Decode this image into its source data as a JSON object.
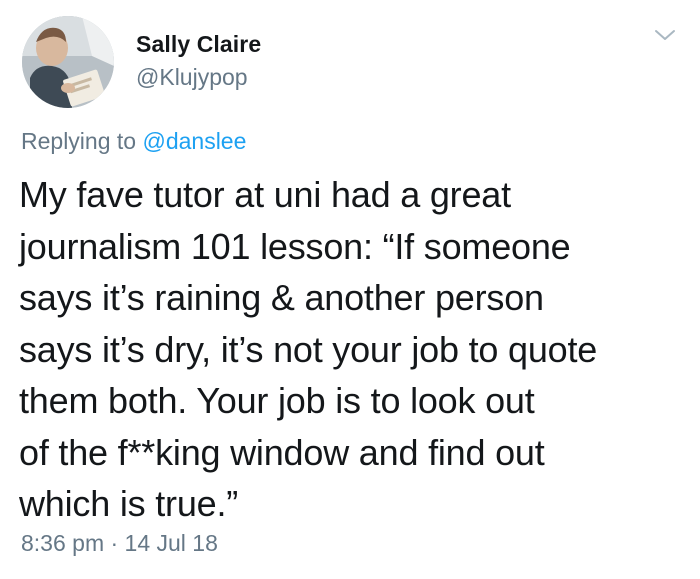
{
  "author": {
    "name": "Sally Claire",
    "handle": "@Klujypop",
    "avatar_icon": "profile-photo"
  },
  "menu_icon": "chevron-down-icon",
  "reply": {
    "prefix": "Replying to ",
    "mention": "@danslee"
  },
  "tweet": {
    "text": "My fave tutor at uni had a great\njournalism 101 lesson: “If someone\nsays it’s raining & another person\nsays it’s dry, it’s not your job to quote\nthem both. Your job is to look out\nof the f**king window and find out\nwhich is true.”"
  },
  "meta": {
    "timestamp": "8:36 pm · 14 Jul 18"
  },
  "colors": {
    "text": "#14171a",
    "secondary": "#657786",
    "link": "#1da1f2",
    "background": "#ffffff"
  }
}
